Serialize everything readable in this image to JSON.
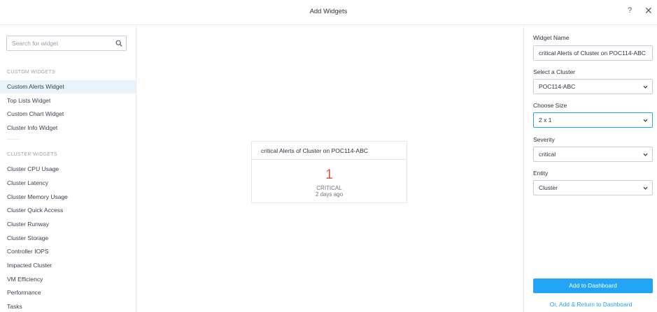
{
  "header": {
    "title": "Add Widgets",
    "help_label": "?",
    "close_label": "✕"
  },
  "sidebar": {
    "search_placeholder": "Search for widget",
    "custom_header": "CUSTOM WIDGETS",
    "custom_items": [
      {
        "label": "Custom Alerts Widget",
        "active": true
      },
      {
        "label": "Top Lists Widget"
      },
      {
        "label": "Custom Chart Widget"
      },
      {
        "label": "Cluster Info Widget"
      }
    ],
    "cluster_header": "CLUSTER WIDGETS",
    "cluster_items": [
      {
        "label": "Cluster CPU Usage"
      },
      {
        "label": "Cluster Latency"
      },
      {
        "label": "Cluster Memory Usage"
      },
      {
        "label": "Cluster Quick Access"
      },
      {
        "label": "Cluster Runway"
      },
      {
        "label": "Cluster Storage"
      },
      {
        "label": "Controller IOPS"
      },
      {
        "label": "Impacted Cluster"
      },
      {
        "label": "VM Efficiency"
      },
      {
        "label": "Performance"
      },
      {
        "label": "Tasks"
      }
    ]
  },
  "preview": {
    "title": "critical Alerts of Cluster on POC114-ABC",
    "count": "1",
    "severity": "CRITICAL",
    "time": "2 days ago"
  },
  "form": {
    "widget_name_label": "Widget Name",
    "widget_name_value": "critical Alerts of Cluster on POC114-ABC",
    "cluster_label": "Select a Cluster",
    "cluster_value": "POC114-ABC",
    "size_label": "Choose Size",
    "size_value": "2 x 1",
    "severity_label": "Severity",
    "severity_value": "critical",
    "entity_label": "Entity",
    "entity_value": "Cluster",
    "add_button": "Add to Dashboard",
    "return_link": "Or, Add & Return to Dashboard"
  },
  "colors": {
    "accent": "#22a5f7",
    "critical": "#e0534d",
    "active_item_bg": "#e9f3fb"
  }
}
